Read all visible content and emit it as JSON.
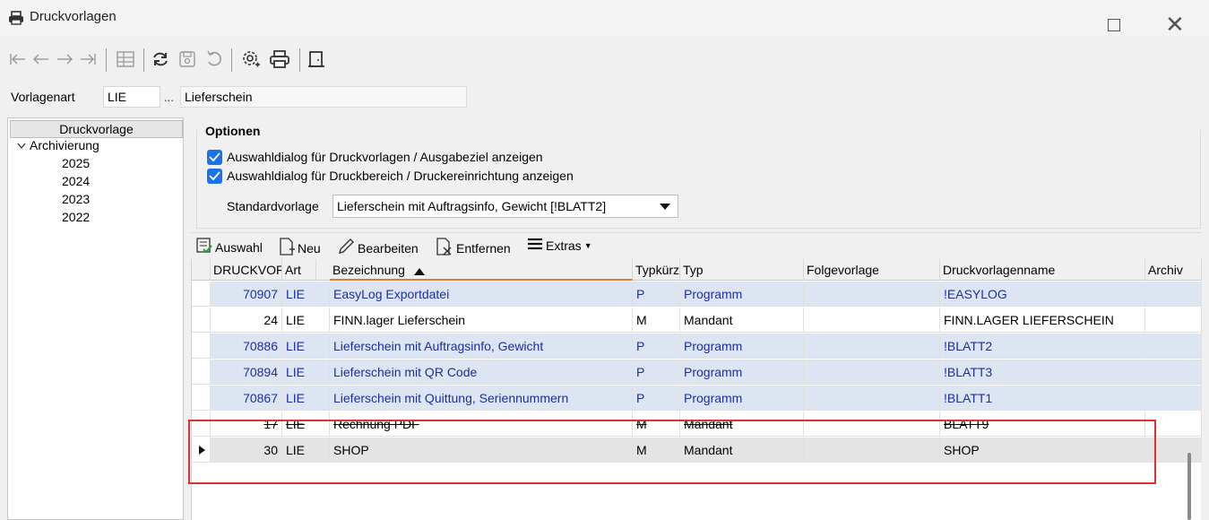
{
  "window": {
    "title": "Druckvorlagen"
  },
  "toolbar": {
    "icons": [
      "first-icon",
      "prev-icon",
      "next-icon",
      "last-icon",
      "grid-icon",
      "refresh-icon",
      "save-icon",
      "undo-icon",
      "settings-icon",
      "print-icon",
      "exit-icon"
    ]
  },
  "vorlagenart": {
    "label": "Vorlagenart",
    "code": "LIE",
    "dots": "...",
    "name": "Lieferschein"
  },
  "tree": {
    "root": "Druckvorlage",
    "group": "Archivierung",
    "years": [
      "2025",
      "2024",
      "2023",
      "2022"
    ]
  },
  "options": {
    "title": "Optionen",
    "check1": "Auswahldialog für Druckvorlagen / Ausgabeziel anzeigen",
    "check2": "Auswahldialog für Druckbereich / Druckereinrichtung anzeigen",
    "std_label": "Standardvorlage",
    "std_value": "Lieferschein mit Auftragsinfo, Gewicht [!BLATT2]"
  },
  "grid_toolbar": {
    "auswahl": "Auswahl",
    "neu": "Neu",
    "bearbeiten": "Bearbeiten",
    "entfernen": "Entfernen",
    "extras": "Extras"
  },
  "grid": {
    "columns": [
      "DRUCKVOR",
      "Art",
      "Bezeichnung",
      "Typkürz",
      "Typ",
      "Folgevorlage",
      "Druckvorlagenname",
      "Archiv"
    ],
    "rows": [
      {
        "id": "70907",
        "art": "LIE",
        "bez": "EasyLog Exportdatei",
        "kz": "P",
        "typ": "Programm",
        "folge": "",
        "name": "!EASYLOG",
        "style": "blue"
      },
      {
        "id": "24",
        "art": "LIE",
        "bez": "FINN.lager Lieferschein",
        "kz": "M",
        "typ": "Mandant",
        "folge": "",
        "name": "FINN.LAGER LIEFERSCHEIN",
        "style": "white"
      },
      {
        "id": "70886",
        "art": "LIE",
        "bez": "Lieferschein mit Auftragsinfo, Gewicht",
        "kz": "P",
        "typ": "Programm",
        "folge": "",
        "name": "!BLATT2",
        "style": "blue"
      },
      {
        "id": "70894",
        "art": "LIE",
        "bez": "Lieferschein mit QR Code",
        "kz": "P",
        "typ": "Programm",
        "folge": "",
        "name": "!BLATT3",
        "style": "blue"
      },
      {
        "id": "70867",
        "art": "LIE",
        "bez": "Lieferschein mit Quittung, Seriennummern",
        "kz": "P",
        "typ": "Programm",
        "folge": "",
        "name": "!BLATT1",
        "style": "blue"
      },
      {
        "id": "17",
        "art": "LIE",
        "bez": "Rechnung PDF",
        "kz": "M",
        "typ": "Mandant",
        "folge": "",
        "name": "BLATT9",
        "style": "white strike"
      },
      {
        "id": "30",
        "art": "LIE",
        "bez": "SHOP",
        "kz": "M",
        "typ": "Mandant",
        "folge": "",
        "name": "SHOP",
        "style": "sel"
      }
    ]
  },
  "colors": {
    "checkbox": "#1a73e8",
    "highlight_box": "#e03030",
    "blue_row_text": "#1c2fa0",
    "blue_row_bg": "#dde5f2"
  }
}
